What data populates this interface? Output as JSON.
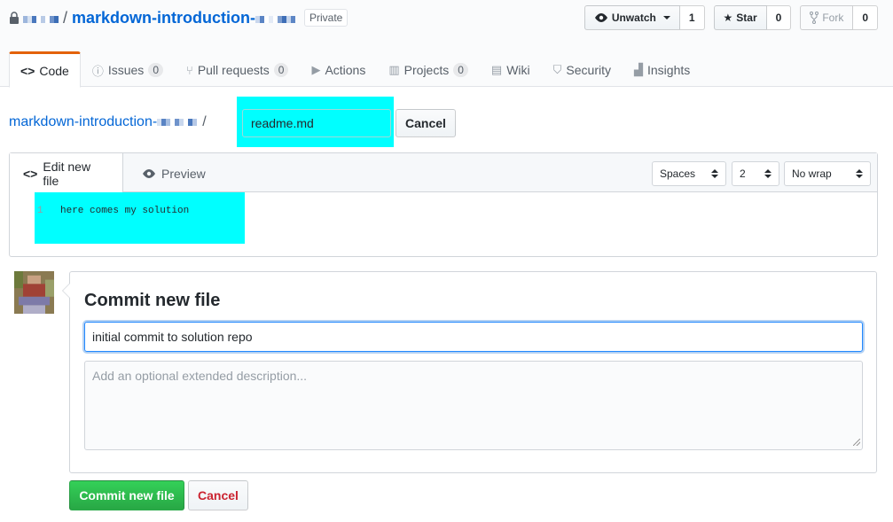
{
  "repo": {
    "name": "markdown-introduction-",
    "visibility": "Private"
  },
  "actions": {
    "watch": {
      "label": "Unwatch",
      "count": "1"
    },
    "star": {
      "label": "Star",
      "count": "0"
    },
    "fork": {
      "label": "Fork",
      "count": "0"
    }
  },
  "nav": [
    {
      "label": "Code",
      "icon": "code-icon"
    },
    {
      "label": "Issues",
      "count": "0",
      "icon": "issue-icon"
    },
    {
      "label": "Pull requests",
      "count": "0",
      "icon": "pull-request-icon"
    },
    {
      "label": "Actions",
      "icon": "play-icon"
    },
    {
      "label": "Projects",
      "count": "0",
      "icon": "project-icon"
    },
    {
      "label": "Wiki",
      "icon": "book-icon"
    },
    {
      "label": "Security",
      "icon": "shield-icon"
    },
    {
      "label": "Insights",
      "icon": "graph-icon"
    }
  ],
  "breadcrumb": {
    "repo": "markdown-introduction-",
    "separator": "/",
    "filename": "readme.md",
    "cancel_label": "Cancel"
  },
  "editor": {
    "edit_tab": "Edit new file",
    "preview_tab": "Preview",
    "indent_mode": "Spaces",
    "indent_size": "2",
    "wrap_mode": "No wrap",
    "lines": [
      {
        "number": "1",
        "text": "here comes my solution"
      }
    ]
  },
  "commit": {
    "title": "Commit new file",
    "summary": "initial commit to solution repo",
    "description_placeholder": "Add an optional extended description...",
    "submit_label": "Commit new file",
    "cancel_label": "Cancel"
  },
  "colors": {
    "link": "#0366d6",
    "highlight": "#00ffff",
    "primary": "#28a745",
    "danger": "#cb2431",
    "nav_selected": "#e36209"
  }
}
